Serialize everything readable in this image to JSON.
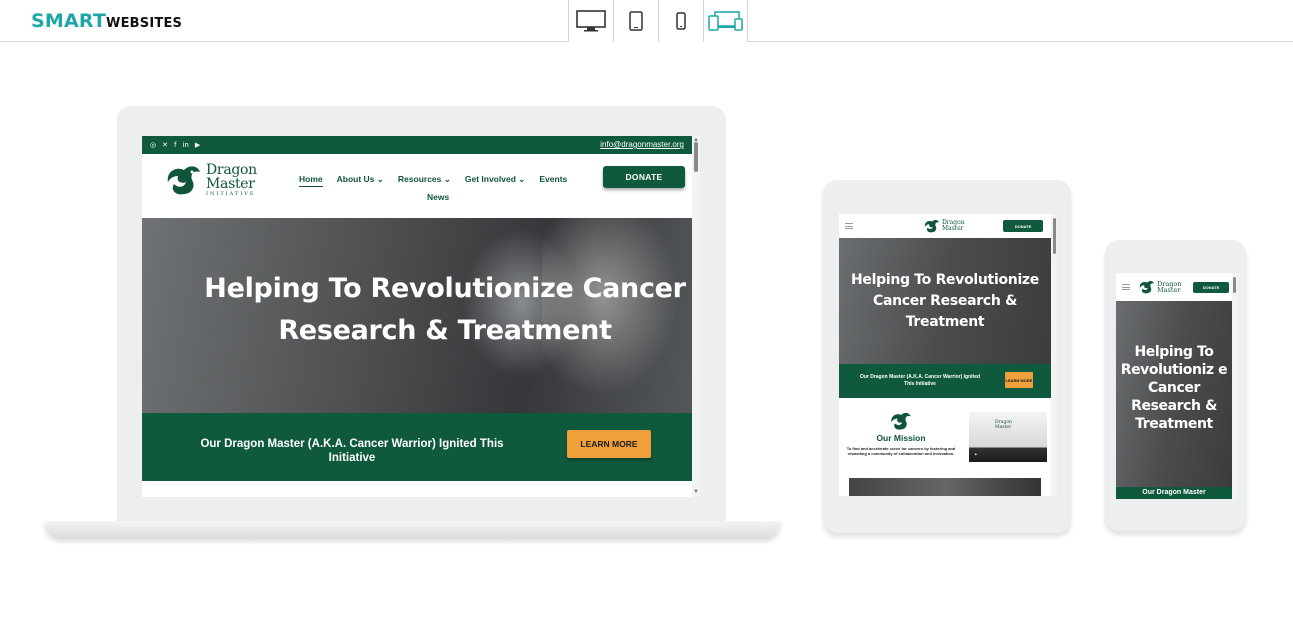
{
  "brand": {
    "part1": "SMART",
    "part2": "WEBSITES"
  },
  "device_switcher": [
    {
      "icon": "desktop-icon"
    },
    {
      "icon": "tablet-icon"
    },
    {
      "icon": "phone-icon"
    },
    {
      "icon": "responsive-icon",
      "active": true
    }
  ],
  "colors": {
    "brand_teal": "#1fa7a8",
    "site_green": "#0f5a3c",
    "cta_orange": "#efa03a"
  },
  "site": {
    "email": "info@dragonmaster.org",
    "socials": [
      "instagram-icon",
      "x-icon",
      "facebook-icon",
      "linkedin-icon",
      "youtube-icon"
    ],
    "logo": {
      "line1": "Dragon",
      "line2": "Master",
      "line3": "INITIATIVE"
    },
    "menu": [
      "Home",
      "About Us",
      "Resources",
      "Get Involved",
      "Events"
    ],
    "menu_second_row": "News",
    "donate": "DONATE",
    "hero_title": "Helping To Revolutionize Cancer Research & Treatment",
    "banner_text": "Our Dragon Master (A.K.A. Cancer Warrior) Ignited This Initiative",
    "learn_more": "LEARN MORE",
    "mission_title": "Our Mission",
    "mission_text": "To find and accelerate cures for cancers by fostering and rewarding a community of collaboration and innovation."
  },
  "phone": {
    "hero_title": "Helping To Revolutioniz e Cancer Research & Treatment",
    "banner_text": "Our Dragon Master"
  }
}
